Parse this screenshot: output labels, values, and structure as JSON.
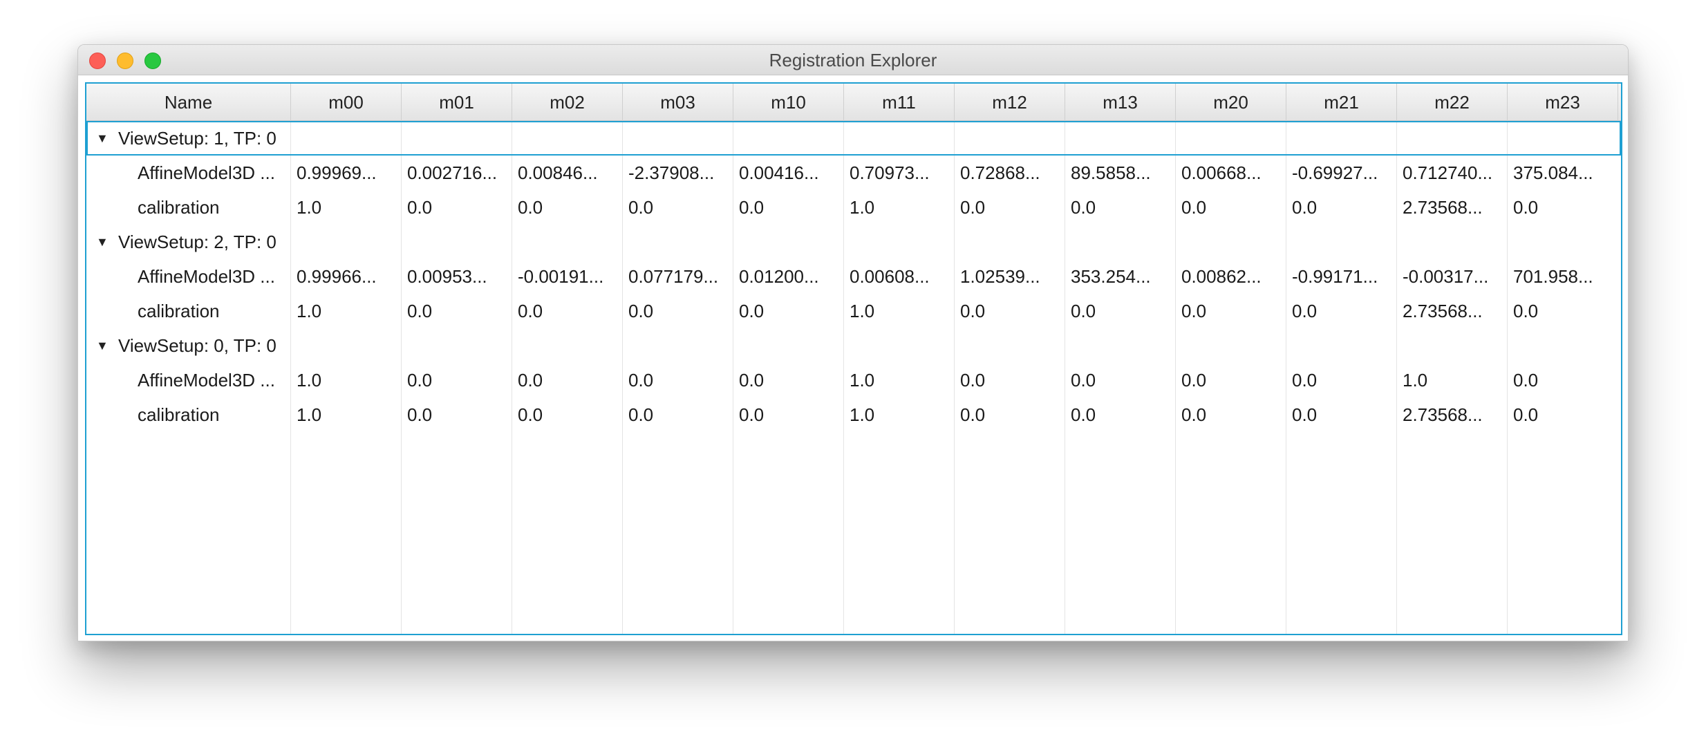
{
  "window": {
    "title": "Registration Explorer"
  },
  "table": {
    "columns": [
      "Name",
      "m00",
      "m01",
      "m02",
      "m03",
      "m10",
      "m11",
      "m12",
      "m13",
      "m20",
      "m21",
      "m22",
      "m23"
    ],
    "rows": [
      {
        "type": "group",
        "name": "ViewSetup: 1, TP: 0",
        "values": []
      },
      {
        "type": "child",
        "name": "AffineModel3D ...",
        "values": [
          "0.99969...",
          "0.002716...",
          "0.00846...",
          "-2.37908...",
          "0.00416...",
          "0.70973...",
          "0.72868...",
          "89.5858...",
          "0.00668...",
          "-0.69927...",
          "0.712740...",
          "375.084..."
        ]
      },
      {
        "type": "child",
        "name": "calibration",
        "values": [
          "1.0",
          "0.0",
          "0.0",
          "0.0",
          "0.0",
          "1.0",
          "0.0",
          "0.0",
          "0.0",
          "0.0",
          "2.73568...",
          "0.0"
        ]
      },
      {
        "type": "group",
        "name": "ViewSetup: 2, TP: 0",
        "values": []
      },
      {
        "type": "child",
        "name": "AffineModel3D ...",
        "values": [
          "0.99966...",
          "0.00953...",
          "-0.00191...",
          "0.077179...",
          "0.01200...",
          "0.00608...",
          "1.02539...",
          "353.254...",
          "0.00862...",
          "-0.99171...",
          "-0.00317...",
          "701.958..."
        ]
      },
      {
        "type": "child",
        "name": "calibration",
        "values": [
          "1.0",
          "0.0",
          "0.0",
          "0.0",
          "0.0",
          "1.0",
          "0.0",
          "0.0",
          "0.0",
          "0.0",
          "2.73568...",
          "0.0"
        ]
      },
      {
        "type": "group",
        "name": "ViewSetup: 0, TP: 0",
        "values": []
      },
      {
        "type": "child",
        "name": "AffineModel3D ...",
        "values": [
          "1.0",
          "0.0",
          "0.0",
          "0.0",
          "0.0",
          "1.0",
          "0.0",
          "0.0",
          "0.0",
          "0.0",
          "1.0",
          "0.0"
        ]
      },
      {
        "type": "child",
        "name": "calibration",
        "values": [
          "1.0",
          "0.0",
          "0.0",
          "0.0",
          "0.0",
          "1.0",
          "0.0",
          "0.0",
          "0.0",
          "0.0",
          "2.73568...",
          "0.0"
        ]
      }
    ],
    "expand_icon": "triangle-down-icon",
    "accent_color": "#1ea0d2"
  }
}
